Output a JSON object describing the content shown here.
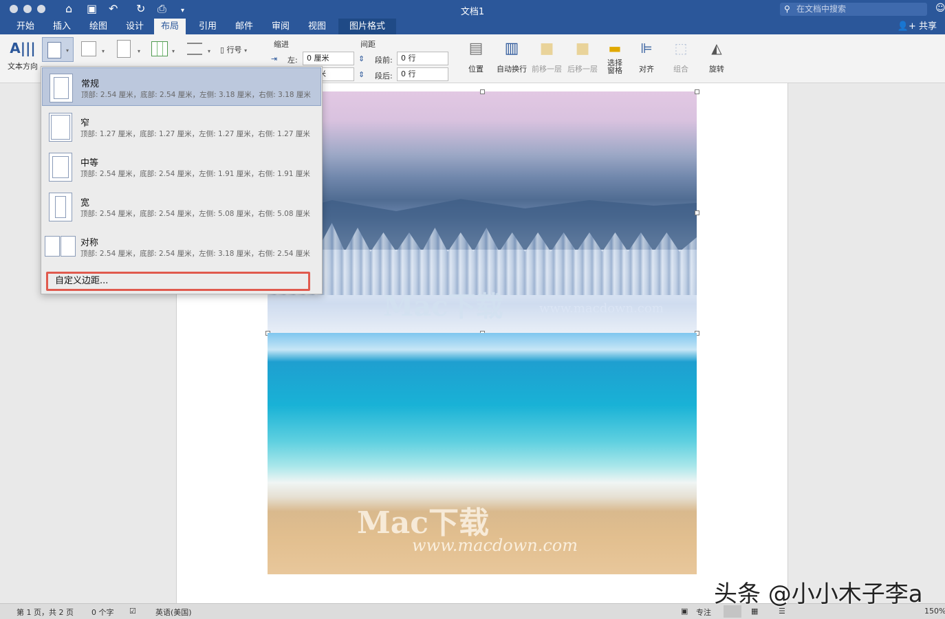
{
  "window": {
    "title": "文档1",
    "search_placeholder": "在文档中搜索"
  },
  "tabs": [
    {
      "label": "开始"
    },
    {
      "label": "插入"
    },
    {
      "label": "绘图"
    },
    {
      "label": "设计"
    },
    {
      "label": "布局"
    },
    {
      "label": "引用"
    },
    {
      "label": "邮件"
    },
    {
      "label": "审阅"
    },
    {
      "label": "视图"
    },
    {
      "label": "图片格式"
    }
  ],
  "share_label": "共享",
  "ribbon": {
    "text_direction": "文本方向",
    "line_numbers": "行号",
    "indent_label": "缩进",
    "spacing_label": "间距",
    "left_label": "左:",
    "left_value": "0 厘米",
    "right_value_partial": "米",
    "before_label": "段前:",
    "before_value": "0 行",
    "after_label": "段后:",
    "after_value": "0 行",
    "position": "位置",
    "wrap_text": "自动换行",
    "bring_forward": "前移一层",
    "send_backward": "后移一层",
    "selection_pane": "选择\n窗格",
    "align": "对齐",
    "group": "组合",
    "rotate": "旋转"
  },
  "margins_menu": {
    "items": [
      {
        "name": "常规",
        "desc": "顶部: 2.54 厘米，底部: 2.54 厘米，左侧: 3.18 厘米，右侧: 3.18 厘米"
      },
      {
        "name": "窄",
        "desc": "顶部: 1.27 厘米，底部: 1.27 厘米，左侧: 1.27 厘米，右侧: 1.27 厘米"
      },
      {
        "name": "中等",
        "desc": "顶部: 2.54 厘米，底部: 2.54 厘米，左侧: 1.91 厘米，右侧: 1.91 厘米"
      },
      {
        "name": "宽",
        "desc": "顶部: 2.54 厘米，底部: 2.54 厘米，左侧: 5.08 厘米，右侧: 5.08 厘米"
      },
      {
        "name": "对称",
        "desc": "顶部: 2.54 厘米，底部: 2.54 厘米，左侧: 3.18 厘米，右侧: 2.54 厘米"
      }
    ],
    "custom": "自定义边距..."
  },
  "watermarks": {
    "brand": "Mac下载",
    "url": "www.macdown.com"
  },
  "status": {
    "page": "第 1 页，共 2 页",
    "words": "0 个字",
    "language": "英语(美国)",
    "focus": "专注",
    "zoom": "150%"
  },
  "overlay_brand": "头条 @小小木子李a",
  "colors": {
    "titlebar": "#2b579a",
    "highlight": "#e05a4e"
  }
}
